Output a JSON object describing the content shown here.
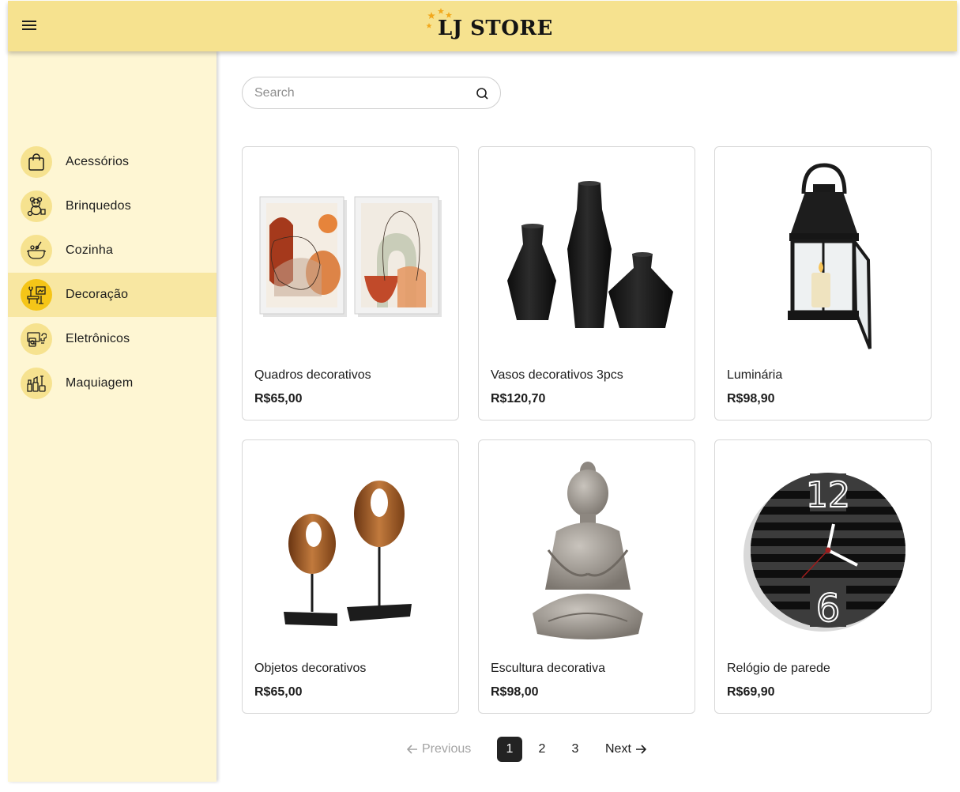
{
  "header": {
    "logo_text": "LJ STORE",
    "brand_color": "#f6e28f",
    "menu_icon": "menu-icon"
  },
  "sidebar": {
    "background": "#fef6d3",
    "active_color": "#f8e7a2",
    "items": [
      {
        "label": "Acessórios",
        "icon": "shopping-bag-icon",
        "active": false
      },
      {
        "label": "Brinquedos",
        "icon": "teddy-bear-icon",
        "active": false
      },
      {
        "label": "Cozinha",
        "icon": "cooking-pot-icon",
        "active": false
      },
      {
        "label": "Decoração",
        "icon": "home-decor-icon",
        "active": true
      },
      {
        "label": "Eletrônicos",
        "icon": "electronics-icon",
        "active": false
      },
      {
        "label": "Maquiagem",
        "icon": "makeup-icon",
        "active": false
      }
    ]
  },
  "search": {
    "placeholder": "Search",
    "value": "",
    "icon": "search-icon"
  },
  "products": [
    {
      "name": "Quadros decorativos",
      "price": "R$65,00",
      "image": "framed-abstract-art-pair"
    },
    {
      "name": "Vasos decorativos 3pcs",
      "price": "R$120,70",
      "image": "black-vases-trio"
    },
    {
      "name": "Luminária",
      "price": "R$98,90",
      "image": "black-lantern"
    },
    {
      "name": "Objetos decorativos",
      "price": "R$65,00",
      "image": "wooden-ring-sculptures"
    },
    {
      "name": "Escultura decorativa",
      "price": "R$98,00",
      "image": "buddha-statue"
    },
    {
      "name": "Relógio de parede",
      "price": "R$69,90",
      "image": "striped-wall-clock"
    }
  ],
  "pagination": {
    "previous_label": "Previous",
    "next_label": "Next",
    "pages": [
      "1",
      "2",
      "3"
    ],
    "current_page": "1",
    "previous_disabled": true
  }
}
